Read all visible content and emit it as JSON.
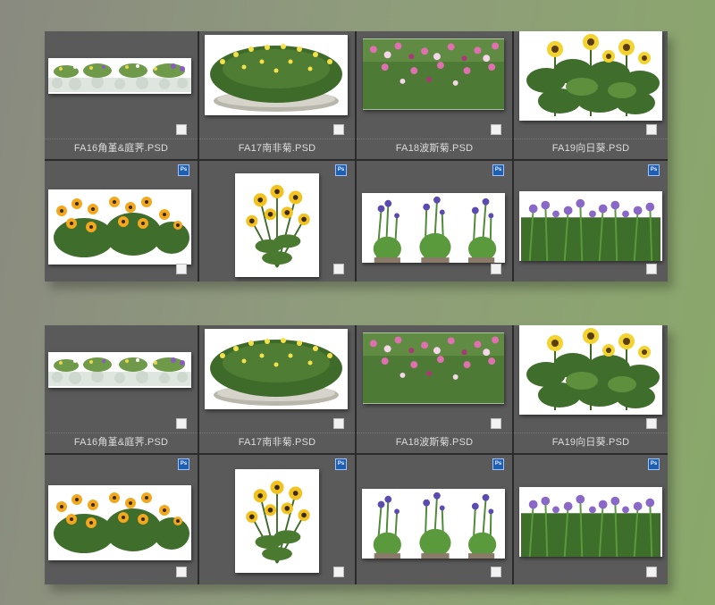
{
  "browser": {
    "panels": [
      {
        "captions": [
          "FA16角堇&庭荠.PSD",
          "FA17南非菊.PSD",
          "FA18波斯菊.PSD",
          "FA19向日葵.PSD"
        ],
        "ps_badge": "Ps"
      },
      {
        "captions": [
          "FA16角堇&庭荠.PSD",
          "FA17南非菊.PSD",
          "FA18波斯菊.PSD",
          "FA19向日葵.PSD"
        ],
        "ps_badge": "Ps"
      }
    ]
  },
  "colors": {
    "cell_bg": "#5a5a5a",
    "panel_border": "#2a2a2a",
    "caption_text": "#dcdcdc",
    "ps_badge": "#1f5fb0"
  },
  "icons": {
    "file_type": "photoshop-file-icon",
    "selection": "checkbox-icon"
  }
}
